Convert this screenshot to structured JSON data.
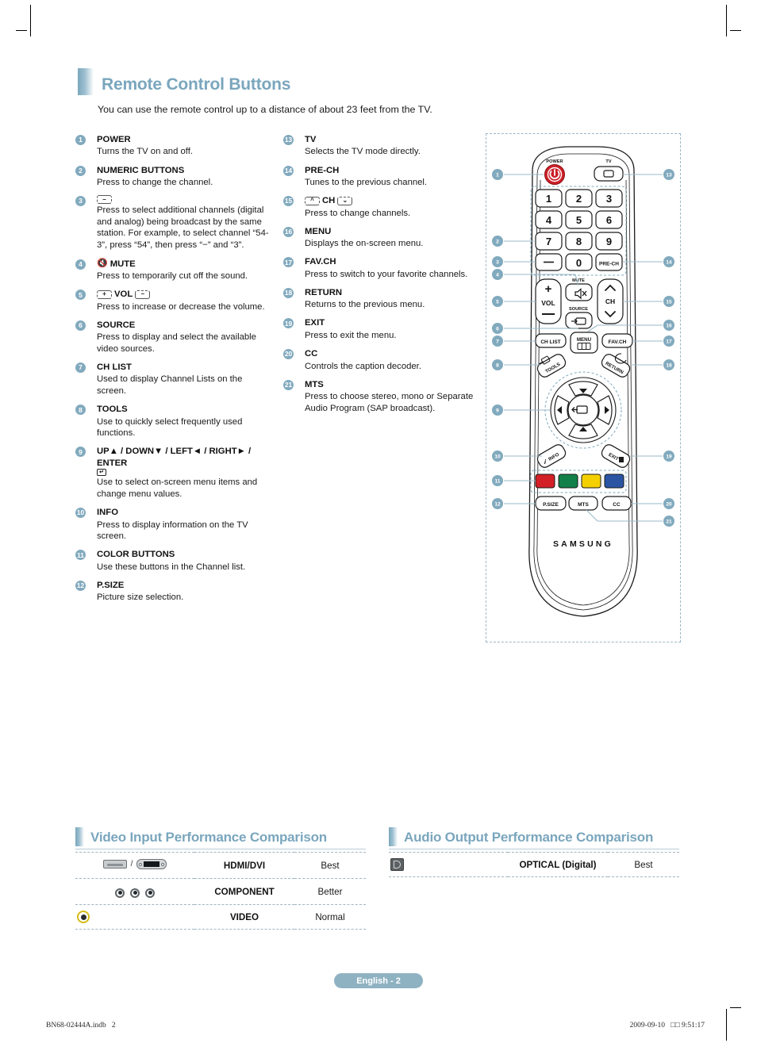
{
  "page": {
    "section_title": "Remote Control Buttons",
    "intro": "You can use the remote control up to a distance of about 23 feet from the TV.",
    "page_label": "English - 2",
    "footer_left": "BN68-02444A.indb   2",
    "footer_right": "2009-09-10   □□ 9:51:17",
    "accent_color": "#7aa6bd",
    "badge_color": "#82aabe"
  },
  "buttons_left": [
    {
      "num": "1",
      "title": "POWER",
      "desc": "Turns the TV on and off."
    },
    {
      "num": "2",
      "title": "NUMERIC BUTTONS",
      "desc": "Press to change the channel."
    },
    {
      "num": "3",
      "title": "",
      "icon": "minus-key",
      "desc": "Press to select additional channels (digital and analog) being broadcast by the same station. For example, to select channel “54-3”, press “54”, then press “−” and “3”."
    },
    {
      "num": "4",
      "title": "MUTE",
      "icon": "mute-icon",
      "desc": "Press to temporarily cut off the sound."
    },
    {
      "num": "5",
      "title": "VOL",
      "icon": "vol-keys",
      "desc": "Press to increase or decrease the volume."
    },
    {
      "num": "6",
      "title": "SOURCE",
      "desc": "Press to display and select the available video sources."
    },
    {
      "num": "7",
      "title": "CH LIST",
      "desc": "Used to display Channel Lists on the screen."
    },
    {
      "num": "8",
      "title": "TOOLS",
      "desc": "Use to quickly select frequently used functions."
    },
    {
      "num": "9",
      "title": "UP▲ / DOWN▼ / LEFT◄ / RIGHT► / ENTER",
      "icon": "enter-icon",
      "desc": "Use to select on-screen menu items and change menu values."
    },
    {
      "num": "10",
      "title": "INFO",
      "desc": "Press to display information on the TV screen."
    },
    {
      "num": "11",
      "title": "COLOR BUTTONS",
      "desc": "Use these buttons in the Channel list."
    },
    {
      "num": "12",
      "title": "P.SIZE",
      "desc": "Picture size selection."
    }
  ],
  "buttons_right": [
    {
      "num": "13",
      "title": "TV",
      "desc": "Selects the TV mode directly."
    },
    {
      "num": "14",
      "title": "PRE-CH",
      "desc": "Tunes to the previous channel."
    },
    {
      "num": "15",
      "title": "CH",
      "icon": "ch-keys",
      "desc": "Press to change channels."
    },
    {
      "num": "16",
      "title": "MENU",
      "desc": "Displays the on-screen menu."
    },
    {
      "num": "17",
      "title": "FAV.CH",
      "desc": "Press to switch to your favorite channels."
    },
    {
      "num": "18",
      "title": "RETURN",
      "desc": "Returns to the previous menu."
    },
    {
      "num": "19",
      "title": "EXIT",
      "desc": "Press to exit the menu."
    },
    {
      "num": "20",
      "title": "CC",
      "desc": "Controls the caption decoder."
    },
    {
      "num": "21",
      "title": "MTS",
      "desc": "Press to choose stereo, mono or Separate Audio Program (SAP broadcast)."
    }
  ],
  "remote": {
    "brand": "SAMSUNG",
    "labels": {
      "power": "POWER",
      "tv": "TV",
      "keys": [
        "1",
        "2",
        "3",
        "4",
        "5",
        "6",
        "7",
        "8",
        "9"
      ],
      "zero": "0",
      "minus": "−",
      "prech": "PRE-CH",
      "mute": "MUTE",
      "source": "SOURCE",
      "vol": "VOL",
      "ch": "CH",
      "chlist": "CH LIST",
      "menu": "MENU",
      "favch": "FAV.CH",
      "tools": "TOOLS",
      "return": "RETURN",
      "info": "INFO",
      "exit": "EXIT",
      "psize": "P.SIZE",
      "mts": "MTS",
      "cc": "CC"
    },
    "color_buttons": [
      "#d32027",
      "#128048",
      "#f5d000",
      "#2b55a3"
    ],
    "power_color": "#cc1f28",
    "callouts_left": [
      "1",
      "2",
      "3",
      "4",
      "5",
      "6",
      "7",
      "8",
      "9",
      "10",
      "11",
      "12"
    ],
    "callouts_right": [
      "13",
      "14",
      "15",
      "16",
      "17",
      "18",
      "19",
      "20",
      "21"
    ]
  },
  "video_comparison": {
    "title": "Video Input Performance Comparison",
    "rows": [
      {
        "icon": "hdmi-dvi-port",
        "name": "HDMI/DVI",
        "rating": "Best"
      },
      {
        "icon": "component-rca",
        "name": "COMPONENT",
        "rating": "Better"
      },
      {
        "icon": "composite-video-rca",
        "name": "VIDEO",
        "rating": "Normal"
      }
    ]
  },
  "audio_comparison": {
    "title": "Audio Output Performance Comparison",
    "rows": [
      {
        "icon": "optical-port",
        "name": "OPTICAL (Digital)",
        "rating": "Best"
      }
    ]
  }
}
